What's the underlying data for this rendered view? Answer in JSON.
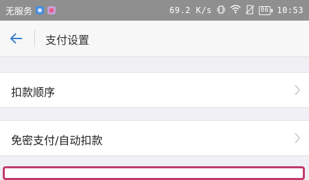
{
  "status_bar": {
    "carrier": "无服务",
    "net_speed": "69.2 K/s",
    "battery_level": "86",
    "time": "10:53"
  },
  "header": {
    "title": "支付设置"
  },
  "rows": [
    {
      "label": "扣款顺序"
    },
    {
      "label": "免密支付/自动扣款"
    }
  ],
  "colors": {
    "accent": "#3b7fd0",
    "highlight": "#c0396c"
  }
}
